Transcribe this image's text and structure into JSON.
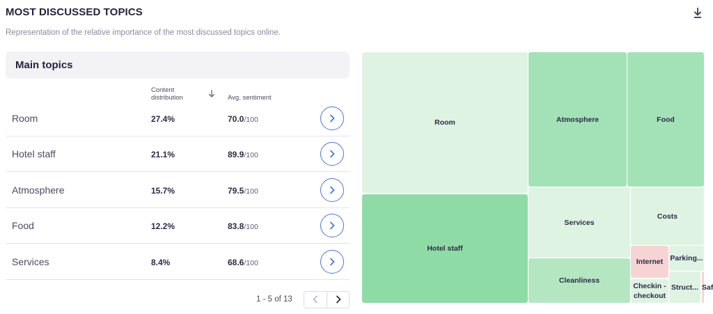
{
  "header": {
    "title": "MOST DISCUSSED TOPICS",
    "subtitle": "Representation of the relative importance of the most discussed topics online."
  },
  "table": {
    "title": "Main topics",
    "col_distribution": "Content distribution",
    "col_sentiment": "Avg. sentiment",
    "sentiment_denominator": "/100",
    "rows": [
      {
        "name": "Room",
        "distribution": "27.4%",
        "sentiment": "70.0"
      },
      {
        "name": "Hotel staff",
        "distribution": "21.1%",
        "sentiment": "89.9"
      },
      {
        "name": "Atmosphere",
        "distribution": "15.7%",
        "sentiment": "79.5"
      },
      {
        "name": "Food",
        "distribution": "12.2%",
        "sentiment": "83.8"
      },
      {
        "name": "Services",
        "distribution": "8.4%",
        "sentiment": "68.6"
      }
    ]
  },
  "pagination": {
    "text": "1 - 5 of 13"
  },
  "treemap": {
    "colors": {
      "light": "#dff3e3",
      "medium": "#b5e6c2",
      "strong": "#a3e2b7",
      "deep": "#8fdba6",
      "negative": "#f7d4d4"
    },
    "tiles": [
      {
        "label": "Room",
        "color": "light"
      },
      {
        "label": "Atmosphere",
        "color": "strong"
      },
      {
        "label": "Food",
        "color": "strong"
      },
      {
        "label": "Hotel staff",
        "color": "deep"
      },
      {
        "label": "Services",
        "color": "light"
      },
      {
        "label": "Costs",
        "color": "light"
      },
      {
        "label": "Cleanliness",
        "color": "medium"
      },
      {
        "label": "Internet",
        "color": "negative"
      },
      {
        "label": "Parking...",
        "color": "light"
      },
      {
        "label": "Checkin - checkout",
        "color": "light"
      },
      {
        "label": "Struct...",
        "color": "light"
      },
      {
        "label": "Safety",
        "color": "light"
      }
    ]
  }
}
